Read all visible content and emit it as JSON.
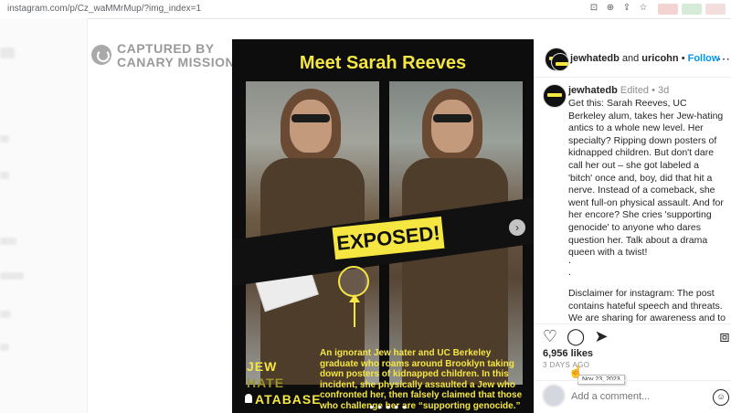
{
  "browser": {
    "url": "instagram.com/p/Cz_waMMrMup/?img_index=1",
    "icons": [
      "install-app-icon",
      "zoom-icon",
      "share-icon",
      "bookmark-star-icon"
    ]
  },
  "watermark": {
    "line1": "CAPTURED BY",
    "line2": "CANARY MISSION"
  },
  "post_image": {
    "title": "Meet Sarah Reeves",
    "banner": "EXPOSED!",
    "logo_lines": [
      "JEW",
      "HATE",
      "ATABASE"
    ],
    "caption": "An ignorant Jew hater and  UC Berkeley graduate who roams around Brooklyn taking down posters of kidnapped children. In this incident, she physically assaulted  a Jew who confronted her, then falsely claimed that those who challenge her are “supporting genocide.”",
    "carousel_dots": "● ● ● ● ●",
    "next_glyph": "›",
    "accent": "#f5e642"
  },
  "header": {
    "author": "jewhatedb",
    "connector": "and",
    "coauthor": "uricohn",
    "separator": "•",
    "follow": "Follow",
    "more": "⋯"
  },
  "caption": {
    "user": "jewhatedb",
    "edited": "Edited",
    "dot": "•",
    "age": "3d",
    "text": "Get this: Sarah Reeves, UC Berkeley alum, takes her Jew-hating antics to a whole new level. Her specialty? Ripping down posters of kidnapped children. But don't dare call her out – she got labeled a 'bitch' once and, boy, did that hit a nerve. Instead of a comeback, she went full-on physical assault. And for her encore? She cries 'supporting genocide' to anyone who dares question her. Talk about a drama queen with a twist!",
    "dots": [
      ".",
      ".",
      "."
    ],
    "disclaimer": "Disclaimer for instagram: The post contains hateful speech and threats. We are sharing for awareness and to aid in"
  },
  "actions": {
    "like": "♡",
    "comment": "◯",
    "share": "➤",
    "save": "⧈"
  },
  "stats": {
    "likes": "6,956 likes",
    "ago": "3 DAYS AGO",
    "tooltip": "Nov 23, 2023"
  },
  "comment_box": {
    "placeholder": "Add a comment...",
    "emoji": "☺"
  }
}
